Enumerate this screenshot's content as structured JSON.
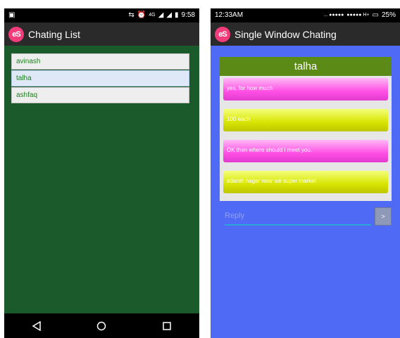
{
  "left_screen": {
    "status_time": "9:58",
    "status_network": "4G",
    "app_title": "Chating List",
    "app_logo": "eS",
    "contacts": [
      "avinash",
      "talha",
      "ashfaq"
    ],
    "selected_contact": "talha",
    "nav_icons": [
      "back-icon",
      "home-icon",
      "recents-icon"
    ]
  },
  "right_screen": {
    "status_time": "12:33AM",
    "status_battery": "25%",
    "app_title": "Single Window Chating",
    "app_logo": "eS",
    "contact_name": "talha",
    "messages": [
      {
        "text": "yes, for how much",
        "style": "pink"
      },
      {
        "text": "100 each",
        "style": "yellow"
      },
      {
        "text": "OK then where should I meet you.",
        "style": "pink"
      },
      {
        "text": "adarsh nagar near sai super market",
        "style": "yellow"
      }
    ],
    "reply_placeholder": "Reply",
    "send_label": ">"
  },
  "colors": {
    "left_bg": "#1b5a2a",
    "right_bg": "#4f6af5",
    "header_green": "#5b8a16",
    "pink_bubble": "#ff4fe4",
    "yellow_bubble": "#d8e400"
  }
}
